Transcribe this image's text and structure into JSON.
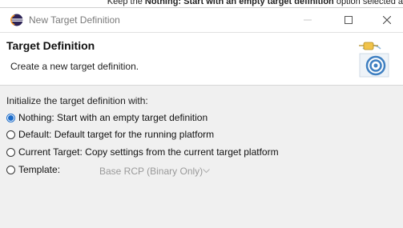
{
  "caption": {
    "prefix": "Keep the ",
    "bold": "Nothing: Start with an empty target definition",
    "suffix": " option selected a"
  },
  "window": {
    "title": "New Target Definition",
    "icon": "eclipse-icon",
    "controls": [
      "minimize-icon",
      "maximize-icon",
      "close-icon"
    ]
  },
  "banner": {
    "title": "Target Definition",
    "description": "Create a new target definition.",
    "icon": "target-definition-icon"
  },
  "content": {
    "group_label": "Initialize the target definition with:",
    "options": [
      {
        "label": "Nothing: Start with an empty target definition",
        "selected": true
      },
      {
        "label": "Default: Default target for the running platform",
        "selected": false
      },
      {
        "label": "Current Target: Copy settings from the current target platform",
        "selected": false
      },
      {
        "label": "Template:",
        "selected": false
      }
    ],
    "template_combo": {
      "value": "Base RCP (Binary Only)",
      "enabled": false
    }
  },
  "colors": {
    "accent": "#1b6bc9",
    "dialog_bg": "#f0f0f0",
    "banner_bg": "#ffffff",
    "disabled_text": "#9a9a9a"
  }
}
